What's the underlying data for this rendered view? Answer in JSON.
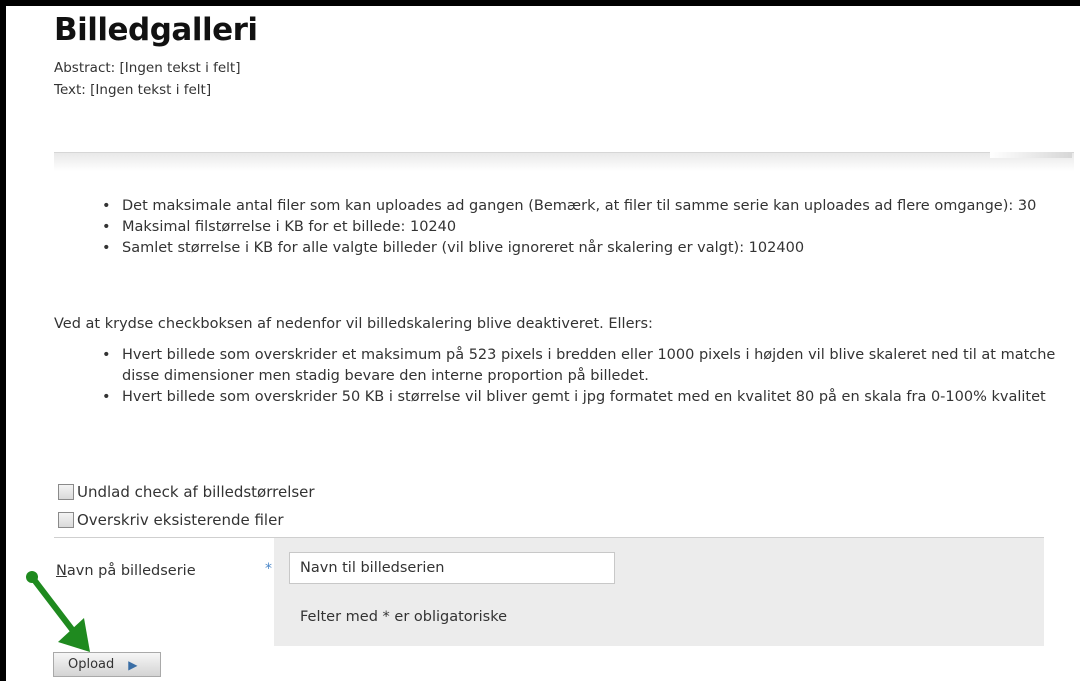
{
  "page": {
    "title": "Billedgalleri",
    "abstract_line": "Abstract: [Ingen tekst i felt]",
    "text_line": "Text: [Ingen tekst i felt]"
  },
  "limits": [
    "Det maksimale antal filer som kan uploades ad gangen (Bemærk, at filer til samme serie kan uploades ad flere omgange): 30",
    "Maksimal filstørrelse i KB for et billede: 10240",
    "Samlet størrelse i KB for alle valgte billeder (vil blive ignoreret når skalering er valgt): 102400"
  ],
  "scaling_note": "Ved at krydse checkboksen af nedenfor vil billedskalering blive deaktiveret. Ellers:",
  "scaling_rules": [
    "Hvert billede som overskrider et maksimum på 523 pixels i bredden eller 1000 pixels i højden vil blive skaleret ned til at matche disse dimensioner men stadig bevare den interne proportion på billedet.",
    "Hvert billede som overskrider 50 KB i størrelse vil bliver gemt i jpg formatet med en kvalitet 80 på en skala fra 0-100% kvalitet"
  ],
  "checkboxes": {
    "skip_size_check": {
      "label": "Undlad check af billedstørrelser",
      "checked": false
    },
    "overwrite_files": {
      "label": "Overskriv eksisterende filer",
      "checked": false
    }
  },
  "form": {
    "series_label_first": "N",
    "series_label_rest": "avn på billedserie",
    "required_marker": "*",
    "series_input_placeholder": "Navn til billedserien",
    "series_input_value": "",
    "required_note": "Felter med * er obligatoriske"
  },
  "upload_button": {
    "label": "Opload",
    "icon": "play-arrow-icon"
  },
  "colors": {
    "annotation_arrow": "#1f8a1f",
    "required_star": "#4a86c7",
    "form_panel": "#ececec"
  }
}
